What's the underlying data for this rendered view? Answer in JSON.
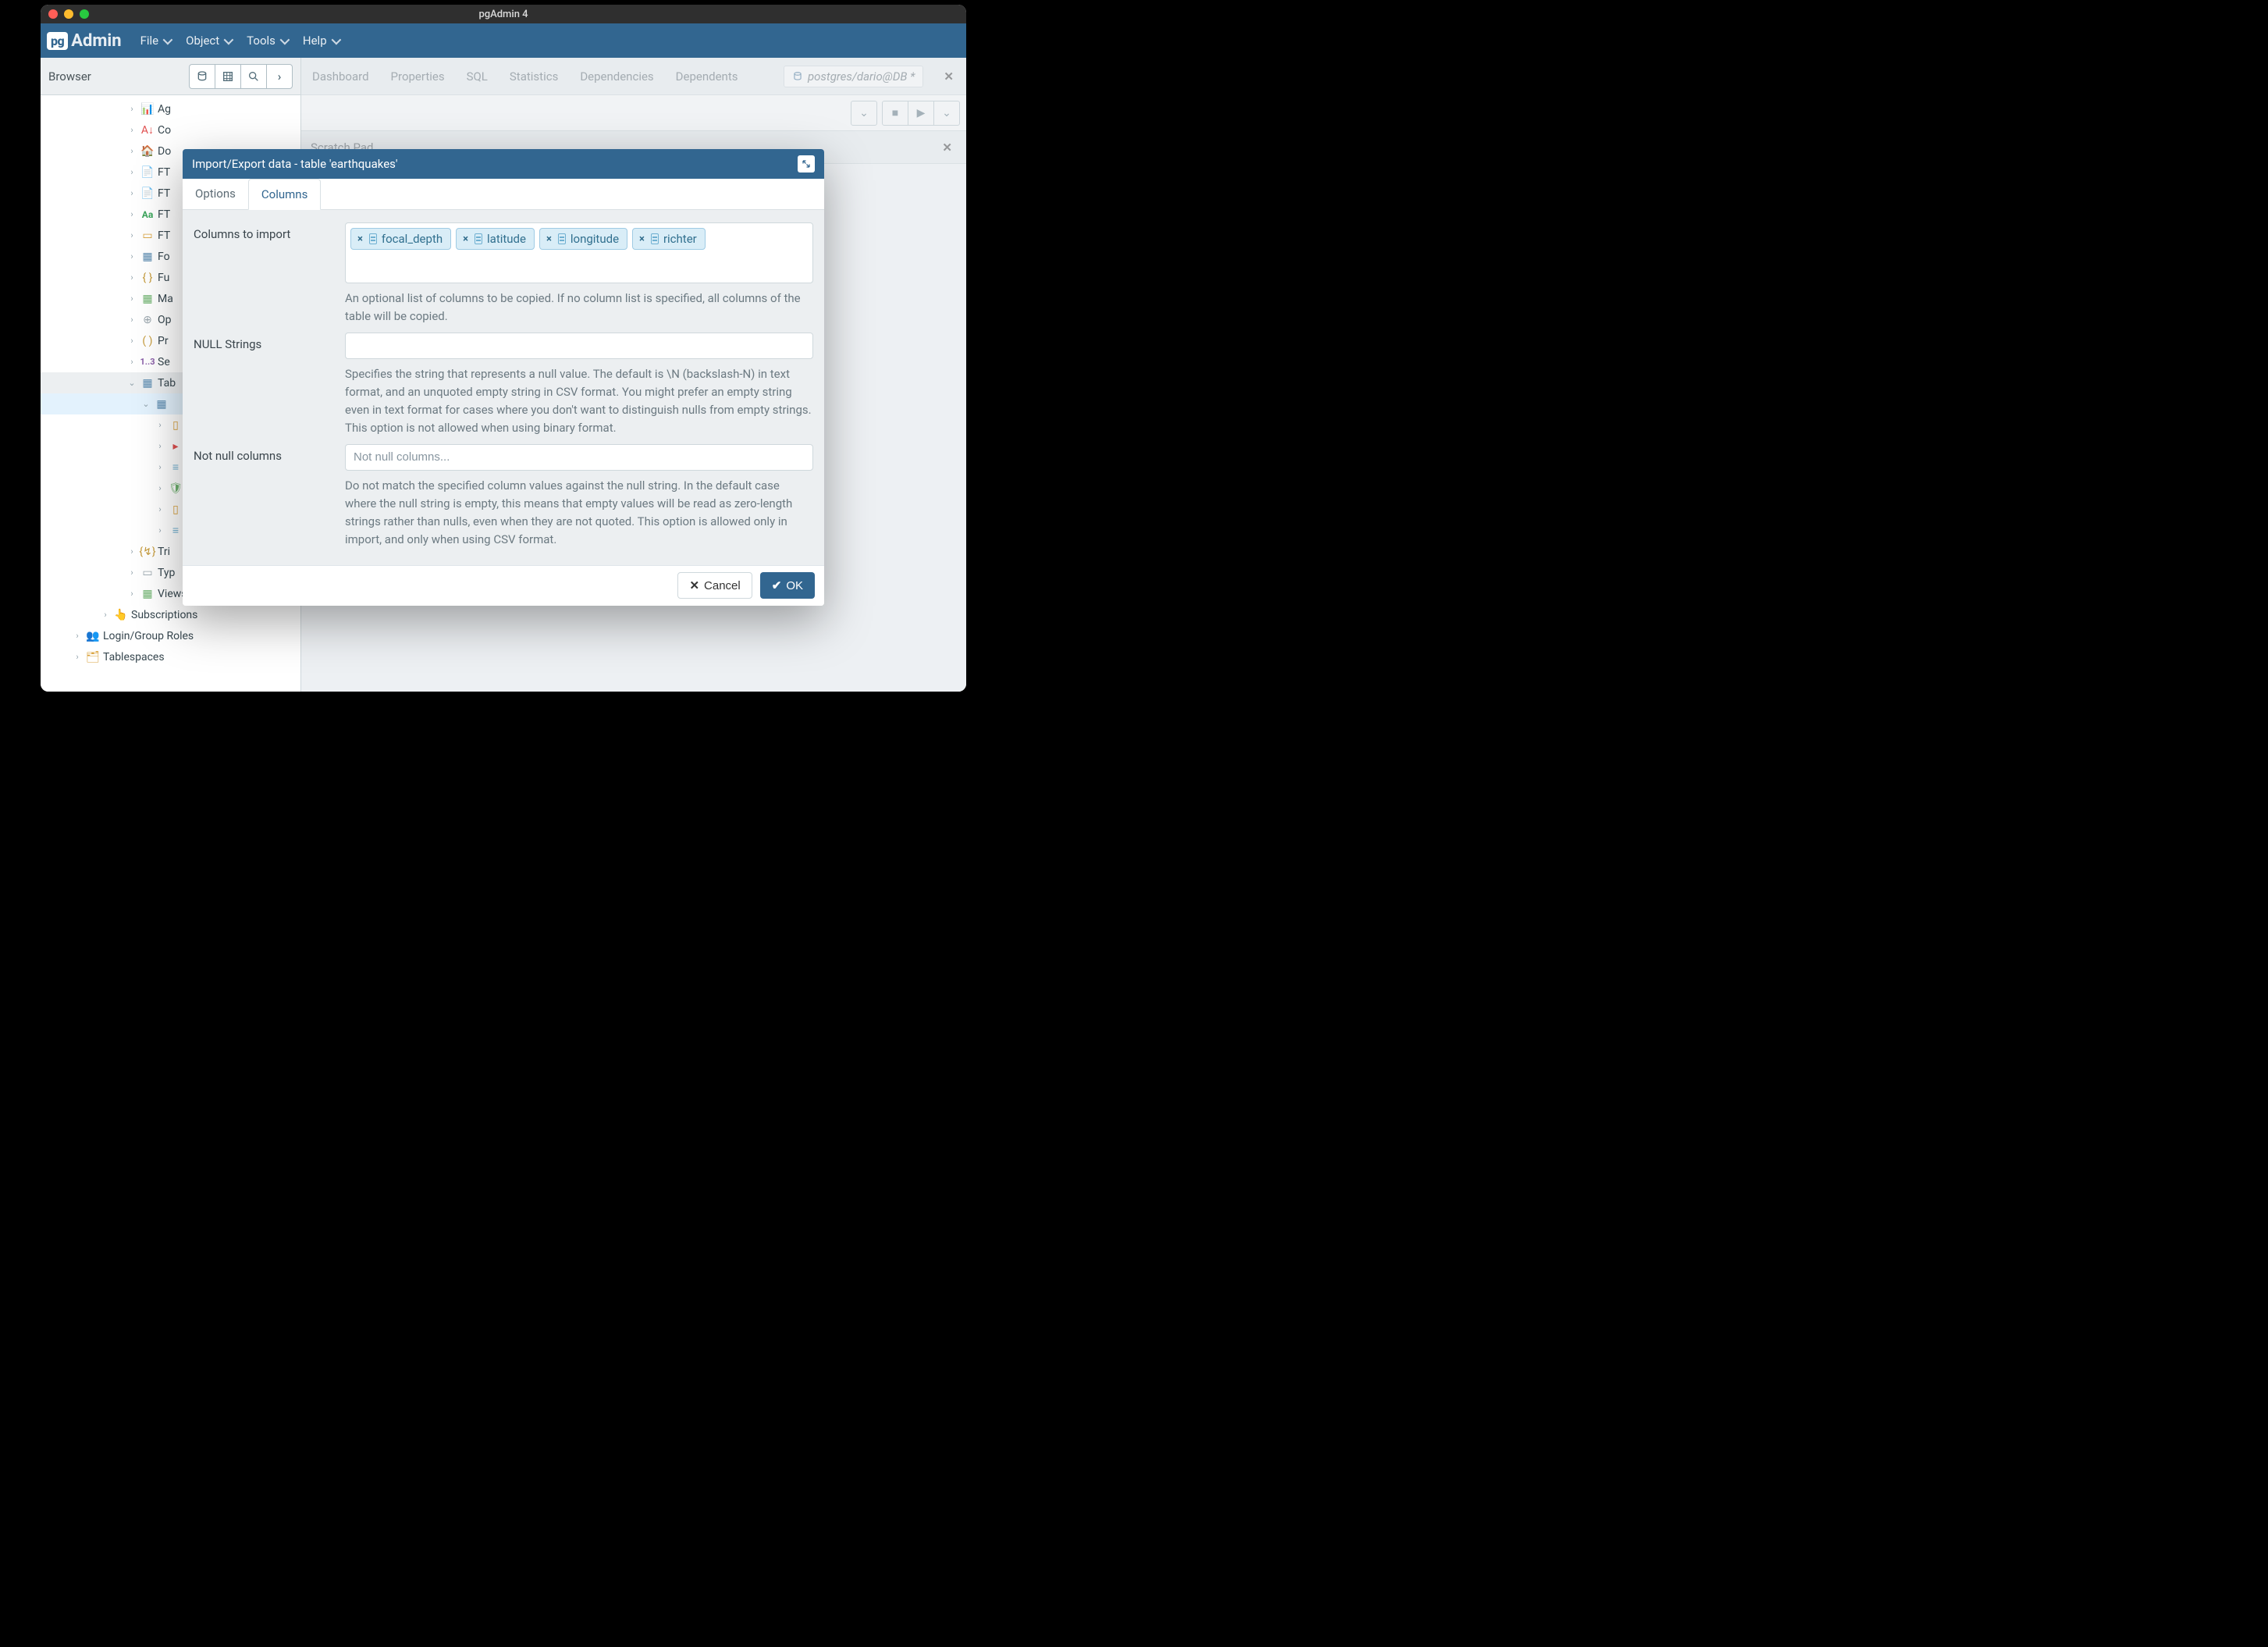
{
  "window": {
    "title": "pgAdmin 4"
  },
  "brand": {
    "badge": "pg",
    "name": "Admin"
  },
  "menus": [
    "File",
    "Object",
    "Tools",
    "Help"
  ],
  "sidebar": {
    "title": "Browser",
    "tree": {
      "ag": "Ag",
      "co": "Co",
      "do": "Do",
      "ft1": "FT",
      "ft2": "FT",
      "ft3": "FT",
      "ft4": "FT",
      "fo": "Fo",
      "fu": "Fu",
      "ma": "Ma",
      "op": "Op",
      "pr": "Pr",
      "se": "Se",
      "tables": "Tab",
      "triggers": "Tri",
      "types": "Typ",
      "views": "Views",
      "subscriptions": "Subscriptions",
      "logingroup": "Login/Group Roles",
      "tablespaces": "Tablespaces"
    }
  },
  "content": {
    "tabs": [
      "Dashboard",
      "Properties",
      "SQL",
      "Statistics",
      "Dependencies",
      "Dependents"
    ],
    "conn_label": "postgres/dario@DB *",
    "scratch": "Scratch Pad"
  },
  "dialog": {
    "title": "Import/Export data - table 'earthquakes'",
    "tabs": {
      "options": "Options",
      "columns": "Columns"
    },
    "labels": {
      "columns_to_import": "Columns to import",
      "null_strings": "NULL Strings",
      "not_null_columns": "Not null columns"
    },
    "columns": [
      "focal_depth",
      "latitude",
      "longitude",
      "richter"
    ],
    "help": {
      "columns": "An optional list of columns to be copied. If no column list is specified, all columns of the table will be copied.",
      "null": "Specifies the string that represents a null value. The default is \\N (backslash-N) in text format, and an unquoted empty string in CSV format. You might prefer an empty string even in text format for cases where you don't want to distinguish nulls from empty strings. This option is not allowed when using binary format.",
      "notnull": "Do not match the specified column values against the null string. In the default case where the null string is empty, this means that empty values will be read as zero-length strings rather than nulls, even when they are not quoted. This option is allowed only in import, and only when using CSV format."
    },
    "placeholders": {
      "notnull": "Not null columns..."
    },
    "buttons": {
      "cancel": "Cancel",
      "ok": "OK"
    }
  }
}
